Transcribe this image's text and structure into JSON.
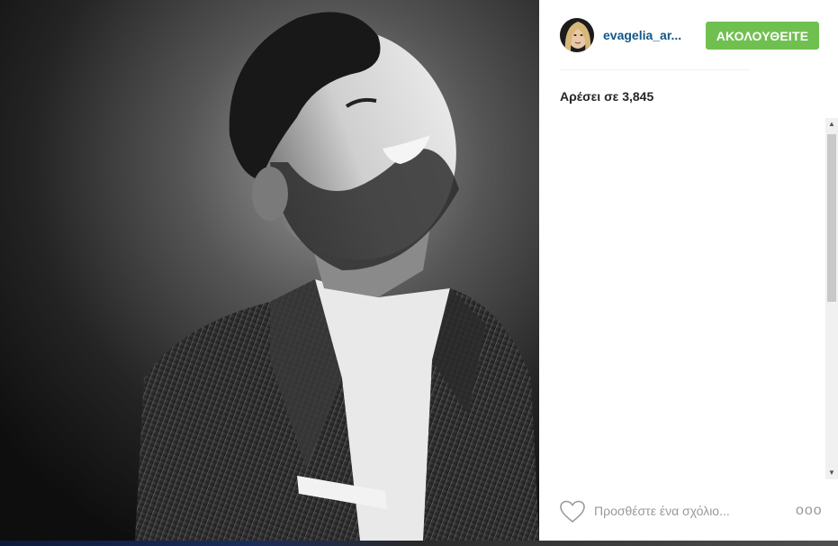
{
  "post": {
    "author": {
      "username": "evagelia_ar...",
      "avatar_icon": "profile-avatar"
    },
    "follow_label": "ΑΚΟΛΟΥΘΕΙΤΕ",
    "likes_text": "Αρέσει σε 3,845",
    "comment": {
      "placeholder": "Προσθέστε ένα σχόλιο...",
      "value": ""
    },
    "more_label": "ooo",
    "icons": {
      "like": "heart-icon",
      "more": "more-options-icon"
    }
  },
  "colors": {
    "username": "#125688",
    "follow_button": "#70c050",
    "text": "#262626",
    "placeholder": "#999999"
  }
}
